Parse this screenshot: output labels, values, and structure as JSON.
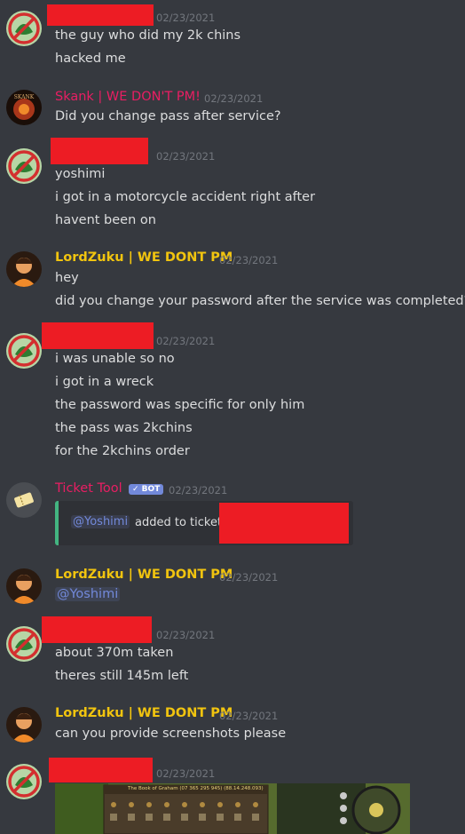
{
  "messages": [
    {
      "id": "m1",
      "author": "",
      "author_color": "#ed1c24",
      "timestamp": "02/23/2021",
      "lines": [
        "the guy who did my 2k chins",
        "hacked me"
      ]
    },
    {
      "id": "m2",
      "author": "Skank | WE DON'T PM!",
      "author_color": "#e91e63",
      "timestamp": "02/23/2021",
      "lines": [
        "Did you change pass after service?"
      ]
    },
    {
      "id": "m3",
      "author": "",
      "author_color": "#ed1c24",
      "timestamp": "02/23/2021",
      "lines": [
        "yoshimi",
        "i got in a motorcycle accident right after",
        "havent been on"
      ]
    },
    {
      "id": "m4",
      "author": "LordZuku | WE DONT PM",
      "author_color": "#f1c40f",
      "timestamp": "02/23/2021",
      "lines": [
        "hey",
        "did you change your password after the service was completed?"
      ]
    },
    {
      "id": "m5",
      "author": "",
      "author_color": "#ed1c24",
      "timestamp": "02/23/2021",
      "lines": [
        "i was unable so no",
        "i got in a wreck",
        "the password was specific for only him",
        "the pass was 2kchins",
        "for the 2kchins order"
      ]
    },
    {
      "id": "m6",
      "author": "Ticket Tool",
      "author_color": "#e91e63",
      "bot_badge": "✓ BOT",
      "timestamp": "02/23/2021",
      "embed": {
        "mention": "@Yoshimi",
        "text": "added to ticket"
      }
    },
    {
      "id": "m7",
      "author": "LordZuku | WE DONT PM",
      "author_color": "#f1c40f",
      "timestamp": "02/23/2021",
      "lines": [
        "@Yoshimi"
      ]
    },
    {
      "id": "m8",
      "author": "",
      "author_color": "#ed1c24",
      "timestamp": "02/23/2021",
      "lines": [
        "about 370m taken",
        "theres still 145m left"
      ]
    },
    {
      "id": "m9",
      "author": "LordZuku | WE DONT PM",
      "author_color": "#f1c40f",
      "timestamp": "02/23/2021",
      "lines": [
        "can you provide screenshots please"
      ]
    },
    {
      "id": "m10",
      "author": "",
      "author_color": "#ed1c24",
      "timestamp": "02/23/2021",
      "attachment": {
        "caption": "The Book of Graham (07 365 295 945) (88.14.248.093)"
      }
    }
  ],
  "colors": {
    "background": "#36393f",
    "text": "#dcddde",
    "timestamp": "#72767d",
    "mention": "#7289da",
    "redaction": "#ed1c24",
    "embed_border": "#43b581"
  }
}
